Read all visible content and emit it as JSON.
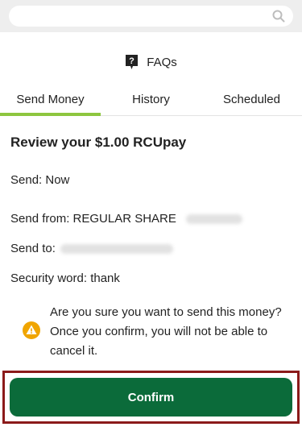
{
  "search": {
    "placeholder": "",
    "icon": "search-icon"
  },
  "faq": {
    "label": "FAQs",
    "icon": "question-icon"
  },
  "tabs": [
    {
      "label": "Send Money",
      "active": true
    },
    {
      "label": "History",
      "active": false
    },
    {
      "label": "Scheduled",
      "active": false
    }
  ],
  "review": {
    "title": "Review your $1.00 RCUpay",
    "send_when": "Send: Now",
    "send_from_label": "Send from: REGULAR SHARE",
    "send_to_label": "Send to:",
    "security_word": "Security word: thank"
  },
  "warning": {
    "icon": "warning-icon",
    "text": "Are you sure you want to send this money? Once you confirm, you will not be able to cancel it."
  },
  "confirm": {
    "label": "Confirm"
  },
  "colors": {
    "accent": "#8dc63f",
    "primary_button": "#0b6b3a",
    "highlight_frame": "#8b1a1a",
    "warning": "#f0a500"
  }
}
